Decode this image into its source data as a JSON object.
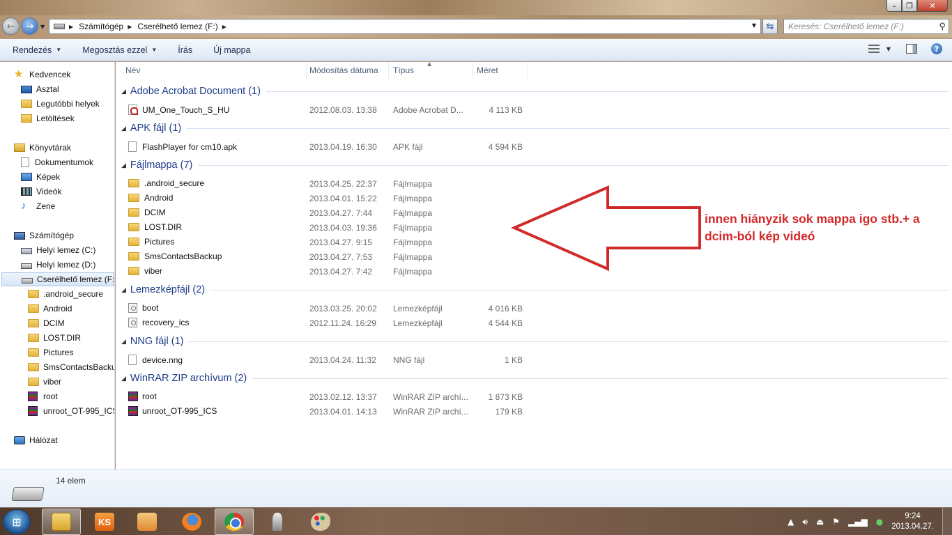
{
  "address": {
    "crumbs": [
      "Számítógép",
      "Cserélhető lemez (F:)"
    ]
  },
  "search": {
    "placeholder": "Keresés: Cserélhető lemez (F:)"
  },
  "toolbar": {
    "organize": "Rendezés",
    "share": "Megosztás ezzel",
    "burn": "Írás",
    "new_folder": "Új mappa"
  },
  "navpane": {
    "favorites": "Kedvencek",
    "desktop": "Asztal",
    "recent": "Legutóbbi helyek",
    "downloads": "Letöltések",
    "libraries": "Könyvtárak",
    "documents": "Dokumentumok",
    "pictures": "Képek",
    "videos": "Videók",
    "music": "Zene",
    "computer": "Számítógép",
    "drive_c": "Helyi lemez (C:)",
    "drive_d": "Helyi lemez (D:)",
    "drive_f": "Cserélhető lemez (F:)",
    "sub": [
      ".android_secure",
      "Android",
      "DCIM",
      "LOST.DIR",
      "Pictures",
      "SmsContactsBacku",
      "viber",
      "root",
      "unroot_OT-995_ICS"
    ],
    "network": "Hálózat"
  },
  "columns": {
    "name": "Név",
    "date": "Módosítás dátuma",
    "type": "Típus",
    "size": "Méret"
  },
  "groups": [
    {
      "title": "Adobe Acrobat Document (1)",
      "rows": [
        {
          "name": "UM_One_Touch_S_HU",
          "date": "2012.08.03. 13:38",
          "type": "Adobe Acrobat D...",
          "size": "4 113 KB"
        }
      ]
    },
    {
      "title": "APK fájl (1)",
      "rows": [
        {
          "name": "FlashPlayer for cm10.apk",
          "date": "2013.04.19. 16:30",
          "type": "APK fájl",
          "size": "4 594 KB"
        }
      ]
    },
    {
      "title": "Fájlmappa (7)",
      "rows": [
        {
          "name": ".android_secure",
          "date": "2013.04.25. 22:37",
          "type": "Fájlmappa",
          "size": ""
        },
        {
          "name": "Android",
          "date": "2013.04.01. 15:22",
          "type": "Fájlmappa",
          "size": ""
        },
        {
          "name": "DCIM",
          "date": "2013.04.27. 7:44",
          "type": "Fájlmappa",
          "size": ""
        },
        {
          "name": "LOST.DIR",
          "date": "2013.04.03. 19:36",
          "type": "Fájlmappa",
          "size": ""
        },
        {
          "name": "Pictures",
          "date": "2013.04.27. 9:15",
          "type": "Fájlmappa",
          "size": ""
        },
        {
          "name": "SmsContactsBackup",
          "date": "2013.04.27. 7:53",
          "type": "Fájlmappa",
          "size": ""
        },
        {
          "name": "viber",
          "date": "2013.04.27. 7:42",
          "type": "Fájlmappa",
          "size": ""
        }
      ]
    },
    {
      "title": "Lemezképfájl (2)",
      "rows": [
        {
          "name": "boot",
          "date": "2013.03.25. 20:02",
          "type": "Lemezképfájl",
          "size": "4 016 KB"
        },
        {
          "name": "recovery_ics",
          "date": "2012.11.24. 16:29",
          "type": "Lemezképfájl",
          "size": "4 544 KB"
        }
      ]
    },
    {
      "title": "NNG fájl (1)",
      "rows": [
        {
          "name": "device.nng",
          "date": "2013.04.24. 11:32",
          "type": "NNG fájl",
          "size": "1 KB"
        }
      ]
    },
    {
      "title": "WinRAR ZIP archívum (2)",
      "rows": [
        {
          "name": "root",
          "date": "2013.02.12. 13:37",
          "type": "WinRAR ZIP archí...",
          "size": "1 873 KB"
        },
        {
          "name": "unroot_OT-995_ICS",
          "date": "2013.04.01. 14:13",
          "type": "WinRAR ZIP archí...",
          "size": "179 KB"
        }
      ]
    }
  ],
  "annotation": {
    "line1": "innen hiányzik sok mappa igo stb.+ a",
    "line2": "dcim-ból kép videó",
    "color": "#d22a2a"
  },
  "details": {
    "count": "14 elem"
  },
  "taskbar": {
    "apps": [
      "explorer",
      "KS",
      "media-player",
      "firefox",
      "chrome",
      "chess",
      "paint"
    ],
    "ks_label": "KS",
    "time": "9:24",
    "date": "2013.04.27."
  }
}
